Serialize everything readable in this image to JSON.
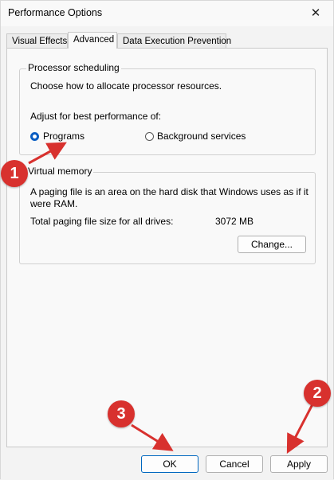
{
  "window": {
    "title": "Performance Options"
  },
  "tabs": [
    {
      "label": "Visual Effects"
    },
    {
      "label": "Advanced",
      "active": true
    },
    {
      "label": "Data Execution Prevention"
    }
  ],
  "processor_scheduling": {
    "legend": "Processor scheduling",
    "description": "Choose how to allocate processor resources.",
    "adjust_label": "Adjust for best performance of:",
    "options": [
      {
        "label": "Programs",
        "selected": true
      },
      {
        "label": "Background services",
        "selected": false
      }
    ]
  },
  "virtual_memory": {
    "legend": "Virtual memory",
    "description_line1": "A paging file is an area on the hard disk that Windows uses as if it",
    "description_line2": "were RAM.",
    "total_label": "Total paging file size for all drives:",
    "total_value": "3072 MB",
    "change_button": "Change..."
  },
  "buttons": {
    "ok": "OK",
    "cancel": "Cancel",
    "apply": "Apply"
  },
  "annotations": [
    {
      "number": "1"
    },
    {
      "number": "2"
    },
    {
      "number": "3"
    }
  ],
  "colors": {
    "accent": "#0067c0",
    "annotation": "#d8312e"
  }
}
